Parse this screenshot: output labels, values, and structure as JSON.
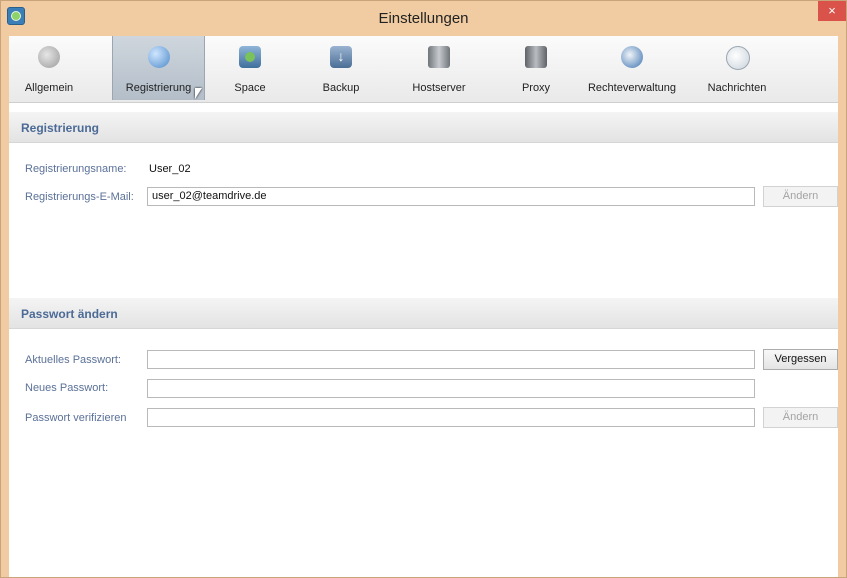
{
  "window": {
    "title": "Einstellungen",
    "close_glyph": "×"
  },
  "tabs": [
    {
      "label": "Allgemein",
      "icon": "gear-icon"
    },
    {
      "label": "Registrierung",
      "icon": "globe-user-icon",
      "active": true
    },
    {
      "label": "Space",
      "icon": "space-icon"
    },
    {
      "label": "Backup",
      "icon": "backup-disk-icon"
    },
    {
      "label": "Hostserver",
      "icon": "server-icon"
    },
    {
      "label": "Proxy",
      "icon": "proxy-icon"
    },
    {
      "label": "Rechteverwaltung",
      "icon": "rights-globe-icon"
    },
    {
      "label": "Nachrichten",
      "icon": "messages-icon"
    }
  ],
  "registration": {
    "title": "Registrierung",
    "name_label": "Registrierungsname:",
    "name_value": "User_02",
    "email_label": "Registrierungs-E-Mail:",
    "email_value": "user_02@teamdrive.de",
    "change_button": "Ändern"
  },
  "password": {
    "title": "Passwort ändern",
    "current_label": "Aktuelles Passwort:",
    "new_label": "Neues Passwort:",
    "verify_label": "Passwort verifizieren",
    "forgot_button": "Vergessen",
    "change_button": "Ändern"
  }
}
